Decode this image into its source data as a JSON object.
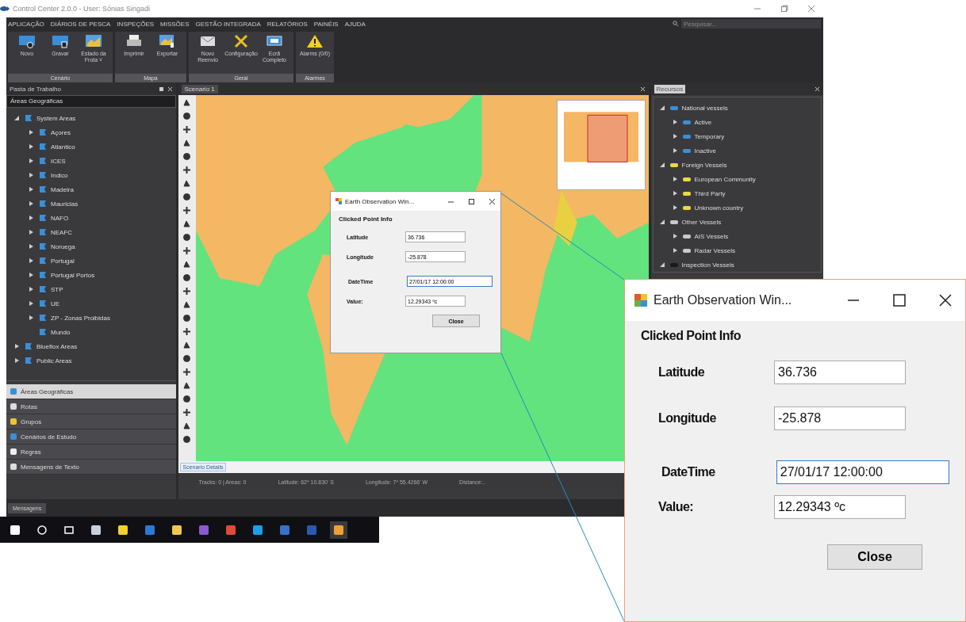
{
  "window": {
    "title": "Control Center 2.0.0 - User: Sónias Singadi"
  },
  "menu": [
    "APLICAÇÃO",
    "DIÁRIOS DE PESCA",
    "INSPEÇÕES",
    "MISSÕES",
    "GESTÃO INTEGRADA",
    "RELATÓRIOS",
    "PAINÉIS",
    "AJUDA"
  ],
  "search": {
    "placeholder": "Pesquisar..."
  },
  "ribbon": [
    {
      "label": "Cenário",
      "buttons": [
        {
          "label": "Novo"
        },
        {
          "label": "Gravar"
        },
        {
          "label": "Estado da Frota ˅"
        }
      ]
    },
    {
      "label": "Mapa",
      "buttons": [
        {
          "label": "Imprimir"
        },
        {
          "label": "Exportar"
        }
      ]
    },
    {
      "label": "Geral",
      "buttons": [
        {
          "label": "Novo Reenvio"
        },
        {
          "label": "Configuração"
        },
        {
          "label": "Ecrã Completo"
        }
      ]
    },
    {
      "label": "Alarmes",
      "buttons": [
        {
          "label": "Alarms (0/0)"
        }
      ]
    }
  ],
  "left_panel": {
    "title": "Pasta de Trabalho",
    "header": "Áreas Geográficas",
    "tree": [
      {
        "label": "System Areas",
        "expanded": true,
        "children": [
          {
            "label": "Açores",
            "expanded": false
          },
          {
            "label": "Atlantico",
            "expanded": false
          },
          {
            "label": "ICES",
            "expanded": false
          },
          {
            "label": "Indico",
            "expanded": false
          },
          {
            "label": "Madeira",
            "expanded": false
          },
          {
            "label": "Mauricias",
            "expanded": false
          },
          {
            "label": "NAFO",
            "expanded": false
          },
          {
            "label": "NEAFC",
            "expanded": false
          },
          {
            "label": "Noruega",
            "expanded": false
          },
          {
            "label": "Portugal",
            "expanded": false
          },
          {
            "label": "Portugal Portos",
            "expanded": false
          },
          {
            "label": "STP",
            "expanded": false
          },
          {
            "label": "UE",
            "expanded": false
          },
          {
            "label": "ZP - Zonas Proibidas",
            "expanded": false
          },
          {
            "label": "Mundo"
          }
        ]
      },
      {
        "label": "Blueflox Areas",
        "expanded": false
      },
      {
        "label": "Public Areas",
        "expanded": false
      }
    ],
    "nav": [
      {
        "label": "Áreas Geográficas",
        "selected": true
      },
      {
        "label": "Rotas",
        "selected": false
      },
      {
        "label": "Grupos",
        "selected": false
      },
      {
        "label": "Cenários de Estudo",
        "selected": false
      },
      {
        "label": "Regras",
        "selected": false
      },
      {
        "label": "Mensagens de Texto",
        "selected": false
      }
    ]
  },
  "map_panel": {
    "tab": "Scenario 1",
    "bottom_tab": "Scenario Details",
    "status": [
      "Tracks: 0 |  Areas: 0",
      "Latitude:  62º 10.830' S",
      "Longitude:  7º 55.4266' W",
      "Distance:.."
    ]
  },
  "right_panel": {
    "title": "Recursos",
    "tree": [
      {
        "label": "National vessels",
        "expanded": true,
        "color": "#3a8fd8",
        "children": [
          {
            "label": "Active",
            "expanded": false,
            "color": "#3a8fd8"
          },
          {
            "label": "Temporary",
            "expanded": false,
            "color": "#3a8fd8"
          },
          {
            "label": "Inactive",
            "expanded": false,
            "color": "#3a8fd8"
          }
        ]
      },
      {
        "label": "Foreign Vessels",
        "expanded": true,
        "color": "#e8d84a",
        "children": [
          {
            "label": "European Community",
            "expanded": false,
            "color": "#e8d84a"
          },
          {
            "label": "Third Party",
            "expanded": false,
            "color": "#e8d84a"
          },
          {
            "label": "Unknown country",
            "expanded": false,
            "color": "#e8d84a"
          }
        ]
      },
      {
        "label": "Other Vessels",
        "expanded": true,
        "color": "#c8c8c8",
        "children": [
          {
            "label": "AIS Vessels",
            "expanded": false,
            "color": "#c8c8c8"
          },
          {
            "label": "Radar Vessels",
            "expanded": false,
            "color": "#c8c8c8"
          }
        ]
      },
      {
        "label": "Inspection Vessels",
        "expanded": true,
        "color": "#1a1a1a"
      }
    ]
  },
  "bottom_tab": "Mensagens",
  "dialog_small": {
    "title": "Earth Observation Win...",
    "heading": "Clicked Point Info",
    "fields": [
      {
        "label": "Latitude",
        "value": "36.736",
        "focused": false
      },
      {
        "label": "Longitude",
        "value": "-25.878",
        "focused": false
      },
      {
        "label": "DateTime",
        "value": "27/01/17 12:00:00",
        "focused": true
      },
      {
        "label": "Value:",
        "value": "12.29343 ºc",
        "focused": false
      }
    ],
    "button": "Close"
  },
  "dialog_zoomed": {
    "title": "Earth Observation Win...",
    "heading": "Clicked Point Info",
    "fields": [
      {
        "label": "Latitude",
        "value": "36.736",
        "focused": false
      },
      {
        "label": "Longitude",
        "value": "-25.878",
        "focused": false
      },
      {
        "label": "DateTime",
        "value": "27/01/17 12:00:00",
        "focused": true
      },
      {
        "label": "Value:",
        "value": "12.29343 ºc",
        "focused": false
      }
    ],
    "button": "Close"
  }
}
